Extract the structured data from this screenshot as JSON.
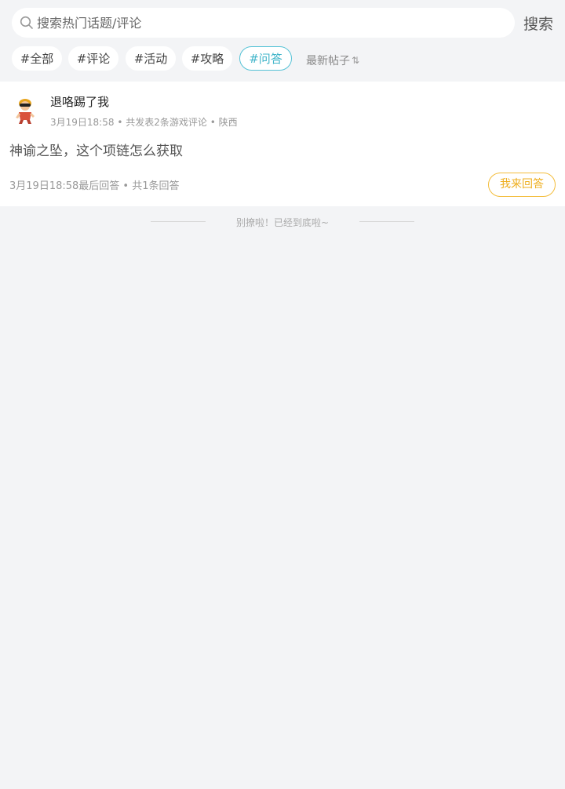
{
  "search": {
    "placeholder": "搜索热门话题/评论",
    "value": "",
    "button_label": "搜索"
  },
  "tags": [
    {
      "label": "#全部",
      "active": false
    },
    {
      "label": "#评论",
      "active": false
    },
    {
      "label": "#活动",
      "active": false
    },
    {
      "label": "#攻略",
      "active": false
    },
    {
      "label": "#问答",
      "active": true
    }
  ],
  "sort": {
    "label": "最新帖子",
    "icon": "sort-arrows-icon"
  },
  "posts": [
    {
      "username": "退咯踢了我",
      "posted_time": "3月19日18:58",
      "review_count_text": "共发表2条游戏评论",
      "location": "陕西",
      "title": "神谕之坠，这个项链怎么获取",
      "last_reply_text": "3月19日18:58最后回答",
      "reply_count_text": "共1条回答",
      "reply_button_label": "我来回答"
    }
  ],
  "list_end": {
    "text": "别撩啦！已经到底啦~"
  },
  "colors": {
    "background": "#f3f4f6",
    "active_tag": "#3fb4c9",
    "reply_button": "#eeae1d"
  }
}
